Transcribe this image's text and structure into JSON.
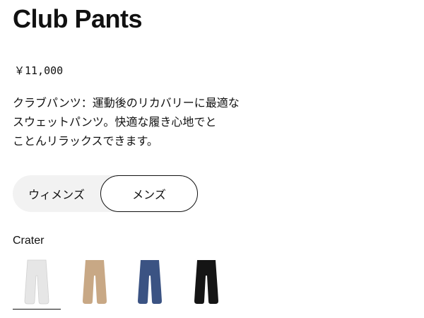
{
  "product": {
    "title": "Club Pants",
    "price": "￥11,000",
    "description_lines": [
      "クラブパンツ：運動後のリカバリーに最適な",
      "スウェットパンツ。快適な履き心地でと",
      "ことんリラックスできます。"
    ]
  },
  "gender_toggle": {
    "options": [
      "ウィメンズ",
      "メンズ"
    ],
    "selected": "メンズ"
  },
  "color": {
    "label": "Crater",
    "swatches": [
      {
        "name": "crater-white-icon",
        "color": "#e6e6e6",
        "selected": true
      },
      {
        "name": "tan-icon",
        "color": "#c8a885",
        "selected": false
      },
      {
        "name": "navy-icon",
        "color": "#3b5383",
        "selected": false
      },
      {
        "name": "black-icon",
        "color": "#151515",
        "selected": false
      }
    ]
  }
}
